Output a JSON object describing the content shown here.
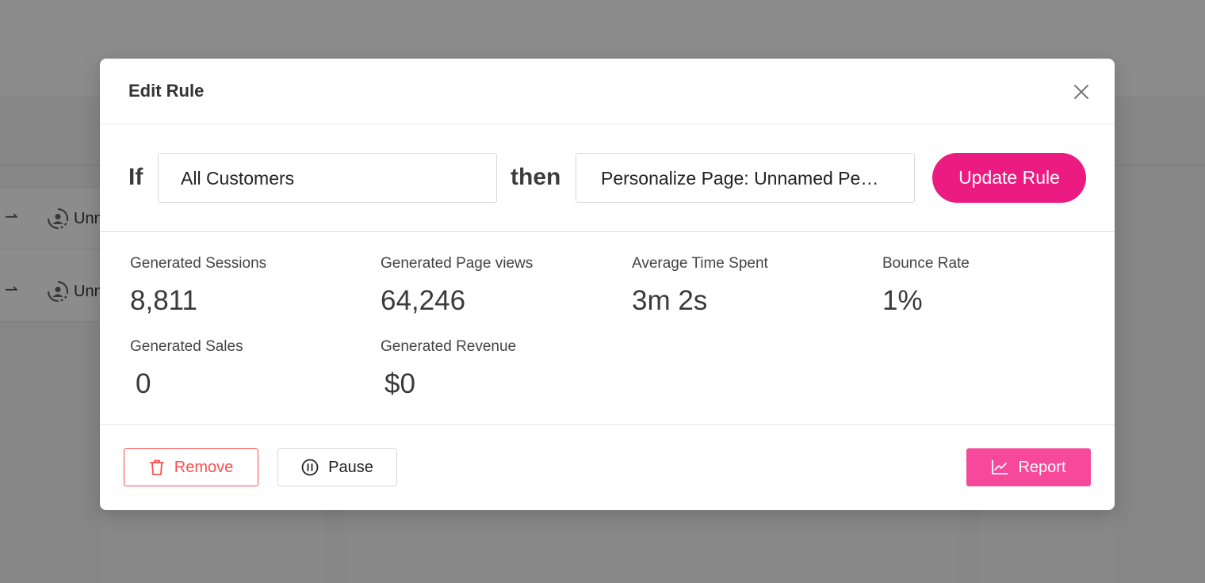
{
  "background": {
    "rows": [
      {
        "name": "Unn"
      },
      {
        "name": "Unn"
      }
    ]
  },
  "modal": {
    "title": "Edit Rule",
    "rule": {
      "if_label": "If",
      "audience_value": "All Customers",
      "then_label": "then",
      "action_value": "Personalize Page: Unnamed Pers...",
      "update_button": "Update Rule"
    },
    "stats": [
      {
        "label": "Generated Sessions",
        "value": "8,811"
      },
      {
        "label": "Generated Page views",
        "value": "64,246"
      },
      {
        "label": "Average Time Spent",
        "value": "3m 2s"
      },
      {
        "label": "Bounce Rate",
        "value": "1%"
      },
      {
        "label": "Generated Sales",
        "value": "0"
      },
      {
        "label": "Generated Revenue",
        "value": "$0"
      }
    ],
    "footer": {
      "remove_button": "Remove",
      "pause_button": "Pause",
      "report_button": "Report"
    }
  },
  "colors": {
    "primary": "#ec1b82",
    "report": "#f7499b",
    "danger": "#ff4d4f",
    "overlay": "rgba(0,0,0,0.45)"
  },
  "icons": {
    "close": "close-icon",
    "remove": "trash-icon",
    "pause": "pause-circle-icon",
    "report": "line-chart-icon",
    "row_arrow": "arrow-right-icon",
    "row_persona": "persona-sync-icon"
  }
}
